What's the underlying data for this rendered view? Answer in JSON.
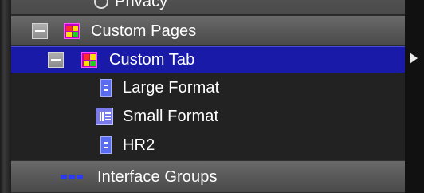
{
  "tree": {
    "top_item": {
      "label": "Privacy",
      "icon": "globe-icon"
    },
    "custom_pages": {
      "label": "Custom Pages",
      "icon": "pages-icon",
      "expanded": true
    },
    "custom_tab": {
      "label": "Custom Tab",
      "icon": "pages-icon",
      "expanded": true,
      "selected": true
    },
    "children": [
      {
        "label": "Large Format",
        "icon": "document-icon"
      },
      {
        "label": "Small Format",
        "icon": "document-list-icon"
      },
      {
        "label": "HR2",
        "icon": "document-icon"
      }
    ],
    "interface_groups": {
      "label": "Interface Groups",
      "icon": "groups-icon"
    }
  },
  "colors": {
    "selected_row": "#1a1aa8",
    "group_row": "#5a5a5a",
    "child_row": "#222222",
    "text": "#ffffff"
  }
}
